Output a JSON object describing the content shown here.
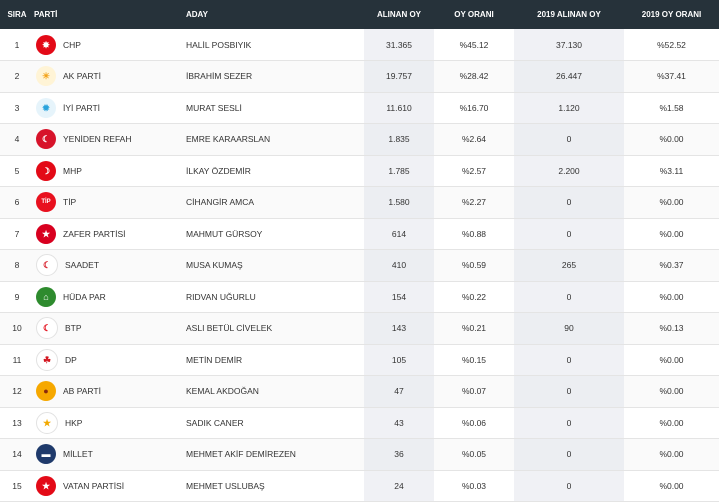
{
  "headers": {
    "sira": "SIRA",
    "parti": "PARTİ",
    "aday": "ADAY",
    "alinan_oy": "ALINAN OY",
    "oy_orani": "OY ORANI",
    "alinan_oy_2019": "2019 ALINAN OY",
    "oy_orani_2019": "2019 OY ORANI"
  },
  "rows": [
    {
      "rank": "1",
      "party": "CHP",
      "candidate": "HALİL POSBIYIK",
      "votes": "31.365",
      "rate": "%45.12",
      "votes2019": "37.130",
      "rate2019": "%52.52",
      "logo_color": "#e30a17",
      "logo_glyph": "✸",
      "logo_fg": "#fff"
    },
    {
      "rank": "2",
      "party": "AK PARTİ",
      "candidate": "İBRAHİM SEZER",
      "votes": "19.757",
      "rate": "%28.42",
      "votes2019": "26.447",
      "rate2019": "%37.41",
      "logo_color": "#fff4d6",
      "logo_glyph": "☀",
      "logo_fg": "#f3a31a"
    },
    {
      "rank": "3",
      "party": "İYİ PARTİ",
      "candidate": "MURAT SESLİ",
      "votes": "11.610",
      "rate": "%16.70",
      "votes2019": "1.120",
      "rate2019": "%1.58",
      "logo_color": "#e6f4fb",
      "logo_glyph": "✹",
      "logo_fg": "#2aa3dc"
    },
    {
      "rank": "4",
      "party": "YENİDEN REFAH",
      "candidate": "EMRE KARAARSLAN",
      "votes": "1.835",
      "rate": "%2.64",
      "votes2019": "0",
      "rate2019": "%0.00",
      "logo_color": "#d7132a",
      "logo_glyph": "☾",
      "logo_fg": "#fff"
    },
    {
      "rank": "5",
      "party": "MHP",
      "candidate": "İLKAY ÖZDEMİR",
      "votes": "1.785",
      "rate": "%2.57",
      "votes2019": "2.200",
      "rate2019": "%3.11",
      "logo_color": "#e30a17",
      "logo_glyph": "☽",
      "logo_fg": "#fff"
    },
    {
      "rank": "6",
      "party": "TİP",
      "candidate": "CİHANGİR AMCA",
      "votes": "1.580",
      "rate": "%2.27",
      "votes2019": "0",
      "rate2019": "%0.00",
      "logo_color": "#e8101e",
      "logo_glyph": "TİP",
      "logo_fg": "#fff"
    },
    {
      "rank": "7",
      "party": "ZAFER PARTİSİ",
      "candidate": "MAHMUT GÜRSOY",
      "votes": "614",
      "rate": "%0.88",
      "votes2019": "0",
      "rate2019": "%0.00",
      "logo_color": "#d8001f",
      "logo_glyph": "★",
      "logo_fg": "#fff"
    },
    {
      "rank": "8",
      "party": "SAADET",
      "candidate": "MUSA KUMAŞ",
      "votes": "410",
      "rate": "%0.59",
      "votes2019": "265",
      "rate2019": "%0.37",
      "logo_color": "#ffffff",
      "logo_glyph": "☾",
      "logo_fg": "#d71f2b"
    },
    {
      "rank": "9",
      "party": "HÜDA PAR",
      "candidate": "RIDVAN UĞURLU",
      "votes": "154",
      "rate": "%0.22",
      "votes2019": "0",
      "rate2019": "%0.00",
      "logo_color": "#2e8b2e",
      "logo_glyph": "⌂",
      "logo_fg": "#fff"
    },
    {
      "rank": "10",
      "party": "BTP",
      "candidate": "ASLI BETÜL CİVELEK",
      "votes": "143",
      "rate": "%0.21",
      "votes2019": "90",
      "rate2019": "%0.13",
      "logo_color": "#ffffff",
      "logo_glyph": "☾",
      "logo_fg": "#e30a17"
    },
    {
      "rank": "11",
      "party": "DP",
      "candidate": "METİN DEMİR",
      "votes": "105",
      "rate": "%0.15",
      "votes2019": "0",
      "rate2019": "%0.00",
      "logo_color": "#ffffff",
      "logo_glyph": "☘",
      "logo_fg": "#d3141e"
    },
    {
      "rank": "12",
      "party": "AB PARTİ",
      "candidate": "KEMAL AKDOĞAN",
      "votes": "47",
      "rate": "%0.07",
      "votes2019": "0",
      "rate2019": "%0.00",
      "logo_color": "#f6a800",
      "logo_glyph": "●",
      "logo_fg": "#8a2a0c"
    },
    {
      "rank": "13",
      "party": "HKP",
      "candidate": "SADIK CANER",
      "votes": "43",
      "rate": "%0.06",
      "votes2019": "0",
      "rate2019": "%0.00",
      "logo_color": "#ffffff",
      "logo_glyph": "★",
      "logo_fg": "#f2a900"
    },
    {
      "rank": "14",
      "party": "MİLLET",
      "candidate": "MEHMET AKİF DEMİREZEN",
      "votes": "36",
      "rate": "%0.05",
      "votes2019": "0",
      "rate2019": "%0.00",
      "logo_color": "#1f3a6b",
      "logo_glyph": "▬",
      "logo_fg": "#fff"
    },
    {
      "rank": "15",
      "party": "VATAN PARTİSİ",
      "candidate": "MEHMET USLUBAŞ",
      "votes": "24",
      "rate": "%0.03",
      "votes2019": "0",
      "rate2019": "%0.00",
      "logo_color": "#e30a17",
      "logo_glyph": "★",
      "logo_fg": "#fff"
    }
  ]
}
